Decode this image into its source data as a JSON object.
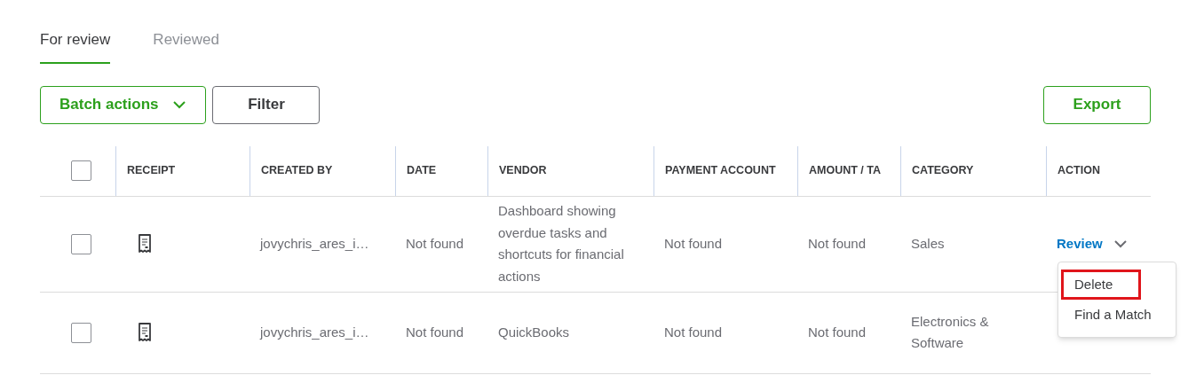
{
  "tabs": [
    {
      "label": "For review",
      "selected": true
    },
    {
      "label": "Reviewed",
      "selected": false
    }
  ],
  "toolbar": {
    "batch_actions": "Batch actions",
    "filter": "Filter",
    "export": "Export"
  },
  "table": {
    "select_all": {
      "checked": false
    },
    "columns": [
      "RECEIPT",
      "CREATED BY",
      "DATE",
      "VENDOR",
      "PAYMENT ACCOUNT",
      "AMOUNT / TA",
      "CATEGORY",
      "ACTION"
    ],
    "rows": [
      {
        "checked": false,
        "created_by": "jovychris_ares_i…",
        "date": "Not found",
        "vendor": "Dashboard showing overdue tasks and shortcuts for financial actions",
        "payment_account": "Not found",
        "amount": "Not found",
        "category": "Sales",
        "action": "Review"
      },
      {
        "checked": false,
        "created_by": "jovychris_ares_i…",
        "date": "Not found",
        "vendor": "QuickBooks",
        "payment_account": "Not found",
        "amount": "Not found",
        "category": "Electronics & Software"
      }
    ]
  },
  "action_menu": {
    "items": [
      {
        "label": "Delete",
        "highlighted": true
      },
      {
        "label": "Find a Match",
        "highlighted": false
      }
    ]
  }
}
